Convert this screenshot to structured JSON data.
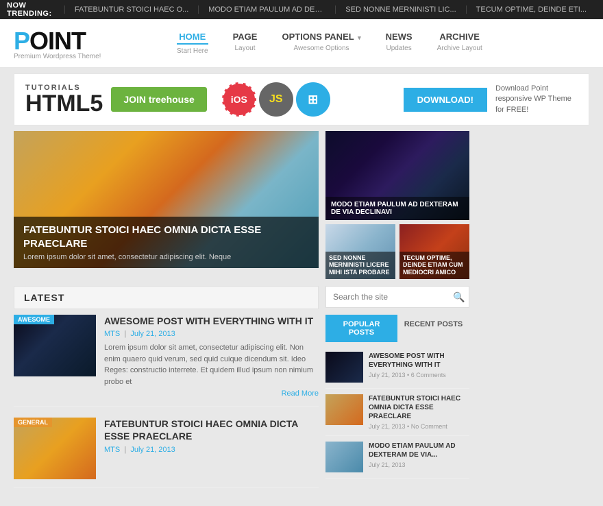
{
  "trending": {
    "label": "NOW TRENDING:",
    "items": [
      "FATEBUNTUR STOICI HAEC O...",
      "MODO ETIAM PAULUM AD DEX...",
      "SED NONNE MERNINISTI LIC...",
      "TECUM OPTIME, DEINDE ETI..."
    ]
  },
  "nav": {
    "logo_text": "POINT",
    "logo_sub": "Premium Wordpress Theme!",
    "items": [
      {
        "label": "HOME",
        "sub": "Start Here",
        "active": true,
        "has_arrow": false
      },
      {
        "label": "PAGE",
        "sub": "Layout",
        "active": false,
        "has_arrow": false
      },
      {
        "label": "OPTIONS PANEL",
        "sub": "Awesome Options",
        "active": false,
        "has_arrow": true
      },
      {
        "label": "NEWS",
        "sub": "Updates",
        "active": false,
        "has_arrow": false
      },
      {
        "label": "ARCHIVE",
        "sub": "Archive Layout",
        "active": false,
        "has_arrow": false
      }
    ]
  },
  "banner": {
    "html5_label": "HTML5",
    "html5_sub": "TUTORIALS",
    "join_btn": "JOIN treehouse",
    "icon1": "iOS",
    "icon2": "JS",
    "download_btn": "DOWNLOAD!",
    "download_text": "Download Point responsive WP Theme for FREE!"
  },
  "featured": {
    "main_title": "FATEBUNTUR STOICI HAEC OMNIA DICTA ESSE PRAECLARE",
    "main_desc": "Lorem ipsum dolor sit amet, consectetur adipiscing elit. Neque",
    "side_title": "MODO ETIAM PAULUM AD DEXTERAM DE VIA DECLINAVI",
    "small1_title": "SED NONNE MERNINISTI LICERE MIHI ISTA PROBARE",
    "small2_title": "TECUM OPTIME, DEINDE ETIAM CUM MEDIOCRI AMICO"
  },
  "latest": {
    "header": "LATEST",
    "posts": [
      {
        "badge": "AWESOME",
        "badge_type": "awesome",
        "title": "AWESOME POST WITH EVERYTHING WITH IT",
        "author": "MTS",
        "date": "July 21, 2013",
        "excerpt": "Lorem ipsum dolor sit amet, consectetur adipiscing elit. Non enim quaero quid verum, sed quid cuique dicendum sit. Ideo Reges: constructio interrete. Et quidem illud ipsum non nimium probo et",
        "read_more": "Read More"
      },
      {
        "badge": "GENERAL",
        "badge_type": "general",
        "title": "FATEBUNTUR STOICI HAEC OMNIA DICTA ESSE PRAECLARE",
        "author": "MTS",
        "date": "July 21, 2013",
        "excerpt": "",
        "read_more": ""
      }
    ]
  },
  "search": {
    "placeholder": "Search the site",
    "btn_icon": "🔍"
  },
  "sidebar": {
    "tab_popular": "POPULAR POSTS",
    "tab_recent": "RECENT POSTS",
    "posts": [
      {
        "title": "AWESOME POST WITH EVERYTHING WITH IT",
        "date": "July 21, 2013",
        "comments": "6 Comments",
        "thumb_type": "1"
      },
      {
        "title": "FATEBUNTUR STOICI HAEC OMNIA DICTA ESSE PRAECLARE",
        "date": "July 21, 2013",
        "comments": "No Comment",
        "thumb_type": "2"
      },
      {
        "title": "MODO ETIAM PAULUM AD DEXTERAM DE VIA...",
        "date": "July 21, 2013",
        "comments": "",
        "thumb_type": "3"
      }
    ]
  }
}
